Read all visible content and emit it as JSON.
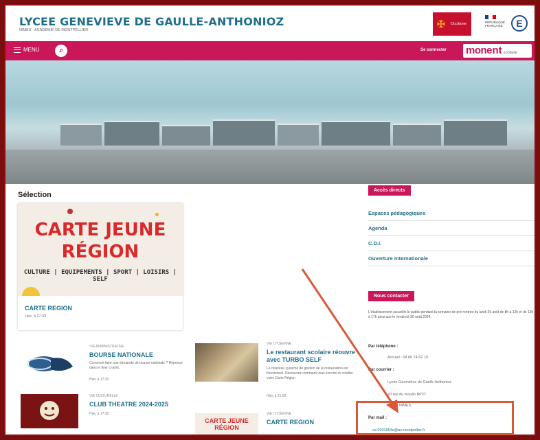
{
  "header": {
    "site_title": "LYCEE GENEVIEVE DE GAULLE-ANTHONIOZ",
    "site_subtitle": "NIMES - ACADEMIE DE MONTPELLIER",
    "region_logo": "Occitanie",
    "republic_logo": "RÉPUBLIQUE FRANÇAISE",
    "edu_logo": "E"
  },
  "navbar": {
    "menu_label": "MENU",
    "login_label": "Se connecter",
    "ent_logo_mon": "mon",
    "ent_logo_ent": "ent",
    "ent_logo_region": "occitanie"
  },
  "selection": {
    "title": "Sélection",
    "featured": {
      "image_line1": "CARTE JEUNE",
      "image_line2": "RÉGION",
      "image_cats": "CULTURE | EQUIPEMENTS | SPORT | LOISIRS | SELF",
      "title": "CARTE REGION",
      "date": "Hier, à 17:33"
    },
    "cards": [
      {
        "category": "VIE ADMINISTRATIVE",
        "title": "BOURSE NATIONALE",
        "desc": "Comment faire une demande de bourse nationale ? Réponse dans le flyer ci-joint.",
        "date": "Hier, à 17:32"
      },
      {
        "category": "VIE LYCÉENNE",
        "title": "Le restaurant scolaire réouvre avec TURBO SELF",
        "desc": "Le nouveau système de gestion de la restauration est fonctionnel. Découvrez comment vous inscrire et créditer votre Carte Région",
        "date": "Hier, à 21:02"
      },
      {
        "category": "VIE CULTURELLE",
        "title": "CLUB THEATRE 2024-2025",
        "date": "Hier, à 17:30"
      },
      {
        "category": "VIE LYCÉENNE",
        "title": "CARTE REGION",
        "image_line1": "CARTE JEUNE",
        "image_line2": "RÉGION"
      }
    ]
  },
  "sidebar": {
    "quick_access_label": "Accès directs",
    "quick_items": [
      "Espaces pédagogiques",
      "Agenda",
      "C.D.I.",
      "Ouverture Internationale"
    ],
    "contact_label": "Nous contacter",
    "contact_text": "L'établissement accueille le public pendant la semaine de pré-rentrée du lundi 26 août de 8h à 12h et de 13h à 17h ainsi que le vendredi 30 août 2024.",
    "phone_label": "Par téléphone :",
    "phone_value": "Accueil : 04 66 74 62 10",
    "mail_label": "Par courrier :",
    "mail_line1": "Lycée Geneviève de Gaulle Anthonioz",
    "mail_line2": "20 rue du moulin BP27",
    "mail_line3": "30000 NIMES",
    "email_label": "Par mail :",
    "email_value": "ce.0301654e@ac-montpellier.fr"
  },
  "colors": {
    "brand_pink": "#c9175a",
    "title_blue": "#1f6f8b",
    "annotation": "#d9583a",
    "frame": "#8b0f0f"
  }
}
